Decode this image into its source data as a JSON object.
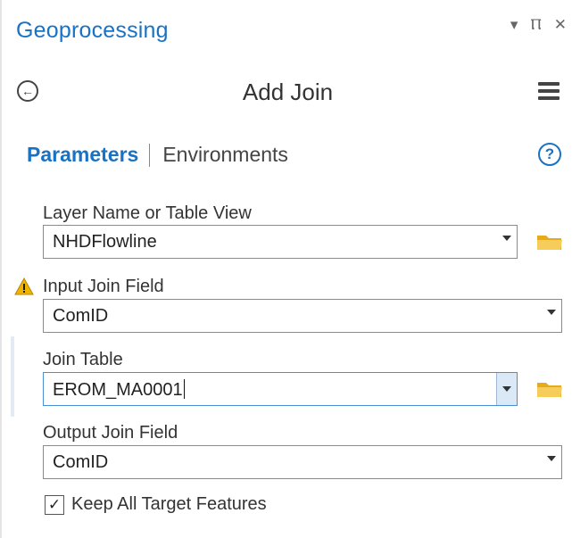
{
  "pane": {
    "title": "Geoprocessing",
    "controls": {
      "dropdown": "▾",
      "pin": "Ⲡ",
      "close": "✕"
    }
  },
  "tool": {
    "title": "Add Join",
    "back_icon": "back-circle-icon",
    "menu_icon": "hamburger-menu-icon"
  },
  "tabs": {
    "parameters": "Parameters",
    "environments": "Environments",
    "help_label": "?"
  },
  "params": {
    "layer": {
      "label": "Layer Name or Table View",
      "value": "NHDFlowline"
    },
    "input_join_field": {
      "label": "Input Join Field",
      "value": "ComID",
      "warning": true
    },
    "join_table": {
      "label": "Join Table",
      "value": "EROM_MA0001"
    },
    "output_join_field": {
      "label": "Output Join Field",
      "value": "ComID"
    },
    "keep_all": {
      "label": "Keep All Target Features",
      "checked": true,
      "mark": "✓"
    }
  },
  "colors": {
    "accent": "#1a72c4",
    "folder": "#f2c14e",
    "warning": "#f0b400"
  }
}
